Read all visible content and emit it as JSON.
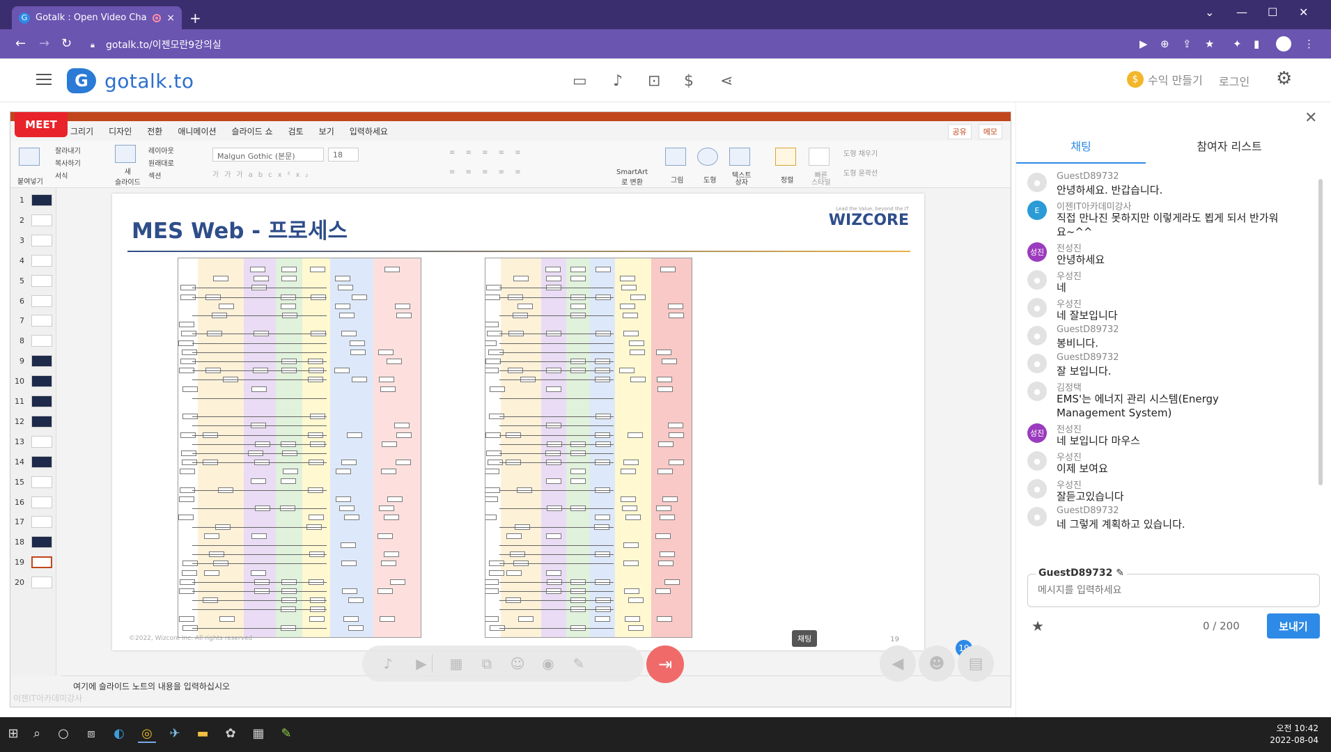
{
  "browser": {
    "tab_title": "Gotalk : Open Video Chat",
    "tab_close": "×",
    "new_tab": "+",
    "url": "gotalk.to/이젠모란9강의실"
  },
  "site": {
    "logo_text": "gotalk.to",
    "earn_label": "수익 만들기",
    "login_label": "로그인"
  },
  "ppt": {
    "meet_label": "MEET",
    "ribbon_tabs": [
      "그리기",
      "디자인",
      "전환",
      "애니메이션",
      "슬라이드 쇼",
      "검토",
      "보기",
      "입력하세요"
    ],
    "share_label": "공유",
    "memo_label": "메모",
    "clipboard": {
      "paste": "붙여넣기",
      "cut": "잘라내기",
      "copy": "복사하기",
      "format": "서식"
    },
    "slides_group": {
      "new_slide": "새\n슬라이드",
      "layout": "레이아웃",
      "reset": "원래대로",
      "section": "섹션"
    },
    "font_name": "Malgun Gothic (본문)",
    "font_size": "18",
    "smartart": "SmartArt\n로 변환",
    "picture": "그림",
    "shape": "도형",
    "textbox": "텍스트\n상자",
    "arrange": "정렬",
    "quick_style": "빠른\n스타일",
    "shape_fill": "도형 채우기",
    "shape_outline": "도형 윤곽선",
    "slide_numbers": [
      "1",
      "2",
      "3",
      "4",
      "5",
      "6",
      "7",
      "8",
      "9",
      "10",
      "11",
      "12",
      "13",
      "14",
      "15",
      "16",
      "17",
      "18",
      "19",
      "20"
    ],
    "slide_title": "MES Web - 프로세스",
    "wizcore": "WIZCORE",
    "wizcore_tag": "Lead the Value, beyond the IT",
    "copyright": "©2022, Wizcore Inc. All rights reserved",
    "page_number": "19",
    "notes_placeholder": "여기에 슬라이드 노트의 내용을 입력하십시오",
    "watermark": "이젠IT아카데미강사",
    "chat_badge": "채팅"
  },
  "controls": {
    "participants_count": "19"
  },
  "chat": {
    "tab_chat": "채팅",
    "tab_participants": "참여자 리스트",
    "messages": [
      {
        "name": "GuestD89732",
        "text": "안녕하세요. 반갑습니다.",
        "avatar": "default"
      },
      {
        "name": "이젠IT아카데미강사",
        "text": "직접 만나진 못하지만 이렇게라도 뵙게 되서 반가워요~^^",
        "avatar": "brand"
      },
      {
        "name": "전성진",
        "text": "안녕하세요",
        "avatar": "성진"
      },
      {
        "name": "우성진",
        "text": "네",
        "avatar": "default"
      },
      {
        "name": "우성진",
        "text": "네 잘보입니다",
        "avatar": "default"
      },
      {
        "name": "GuestD89732",
        "text": "봉비니다.",
        "avatar": "default"
      },
      {
        "name": "GuestD89732",
        "text": "잘 보입니다.",
        "avatar": "default"
      },
      {
        "name": "김정택",
        "text": "EMS'는 에너지 관리 시스템(Energy Management System)",
        "avatar": "default"
      },
      {
        "name": "전성진",
        "text": "네 보입니다 마우스",
        "avatar": "성진"
      },
      {
        "name": "우성진",
        "text": "이제 보여요",
        "avatar": "default"
      },
      {
        "name": "우성진",
        "text": "잘듣고있습니다",
        "avatar": "default"
      },
      {
        "name": "GuestD89732",
        "text": "네 그렇게 계획하고 있습니다.",
        "avatar": "default"
      }
    ],
    "my_name": "GuestD89732",
    "input_placeholder": "메시지를 입력하세요",
    "counter": "0 / 200",
    "send_label": "보내기"
  },
  "taskbar": {
    "time": "오전 10:42",
    "date": "2022-08-04"
  },
  "colors": {
    "brand_purple": "#6a55b0",
    "accent_blue": "#2d8ae6",
    "ppt_orange": "#c2461c",
    "leave_red": "#f06a6a"
  }
}
